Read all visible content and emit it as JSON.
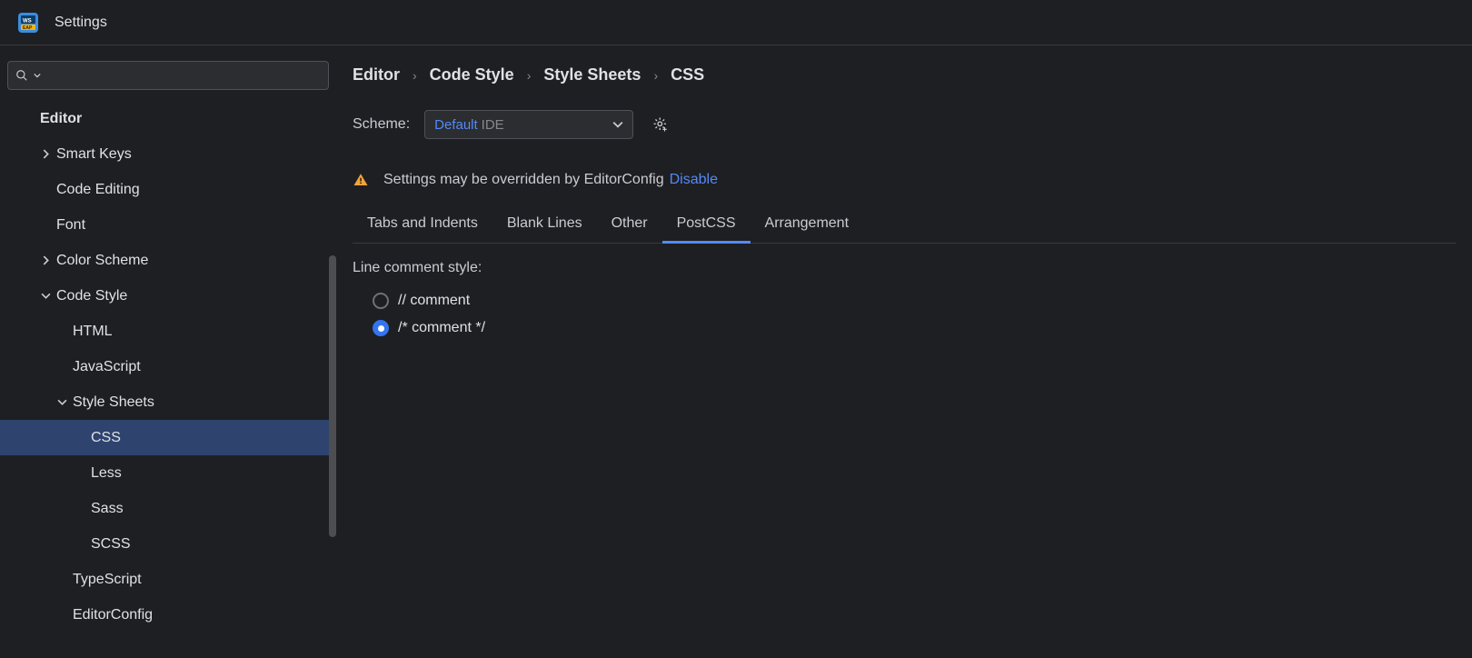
{
  "window": {
    "title": "Settings"
  },
  "search": {
    "value": "",
    "placeholder": ""
  },
  "tree": [
    {
      "label": "Editor",
      "indent": 0,
      "expandable": false,
      "expanded": false,
      "bold": true,
      "selected": false
    },
    {
      "label": "Smart Keys",
      "indent": 1,
      "expandable": true,
      "expanded": false,
      "bold": false,
      "selected": false
    },
    {
      "label": "Code Editing",
      "indent": 1,
      "expandable": false,
      "expanded": false,
      "bold": false,
      "selected": false
    },
    {
      "label": "Font",
      "indent": 1,
      "expandable": false,
      "expanded": false,
      "bold": false,
      "selected": false
    },
    {
      "label": "Color Scheme",
      "indent": 1,
      "expandable": true,
      "expanded": false,
      "bold": false,
      "selected": false
    },
    {
      "label": "Code Style",
      "indent": 1,
      "expandable": true,
      "expanded": true,
      "bold": false,
      "selected": false
    },
    {
      "label": "HTML",
      "indent": 2,
      "expandable": false,
      "expanded": false,
      "bold": false,
      "selected": false
    },
    {
      "label": "JavaScript",
      "indent": 2,
      "expandable": false,
      "expanded": false,
      "bold": false,
      "selected": false
    },
    {
      "label": "Style Sheets",
      "indent": 2,
      "expandable": true,
      "expanded": true,
      "bold": false,
      "selected": false
    },
    {
      "label": "CSS",
      "indent": 3,
      "expandable": false,
      "expanded": false,
      "bold": false,
      "selected": true
    },
    {
      "label": "Less",
      "indent": 3,
      "expandable": false,
      "expanded": false,
      "bold": false,
      "selected": false
    },
    {
      "label": "Sass",
      "indent": 3,
      "expandable": false,
      "expanded": false,
      "bold": false,
      "selected": false
    },
    {
      "label": "SCSS",
      "indent": 3,
      "expandable": false,
      "expanded": false,
      "bold": false,
      "selected": false
    },
    {
      "label": "TypeScript",
      "indent": 2,
      "expandable": false,
      "expanded": false,
      "bold": false,
      "selected": false
    },
    {
      "label": "EditorConfig",
      "indent": 2,
      "expandable": false,
      "expanded": false,
      "bold": false,
      "selected": false
    }
  ],
  "breadcrumb": [
    "Editor",
    "Code Style",
    "Style Sheets",
    "CSS"
  ],
  "scheme": {
    "label": "Scheme:",
    "value": "Default",
    "suffix": "IDE"
  },
  "warning": {
    "text": "Settings may be overridden by EditorConfig",
    "link": "Disable"
  },
  "tabs": [
    {
      "label": "Tabs and Indents",
      "active": false
    },
    {
      "label": "Blank Lines",
      "active": false
    },
    {
      "label": "Other",
      "active": false
    },
    {
      "label": "PostCSS",
      "active": true
    },
    {
      "label": "Arrangement",
      "active": false
    }
  ],
  "postcss": {
    "section_title": "Line comment style:",
    "options": [
      {
        "label": "// comment",
        "checked": false
      },
      {
        "label": "/* comment */",
        "checked": true
      }
    ]
  }
}
